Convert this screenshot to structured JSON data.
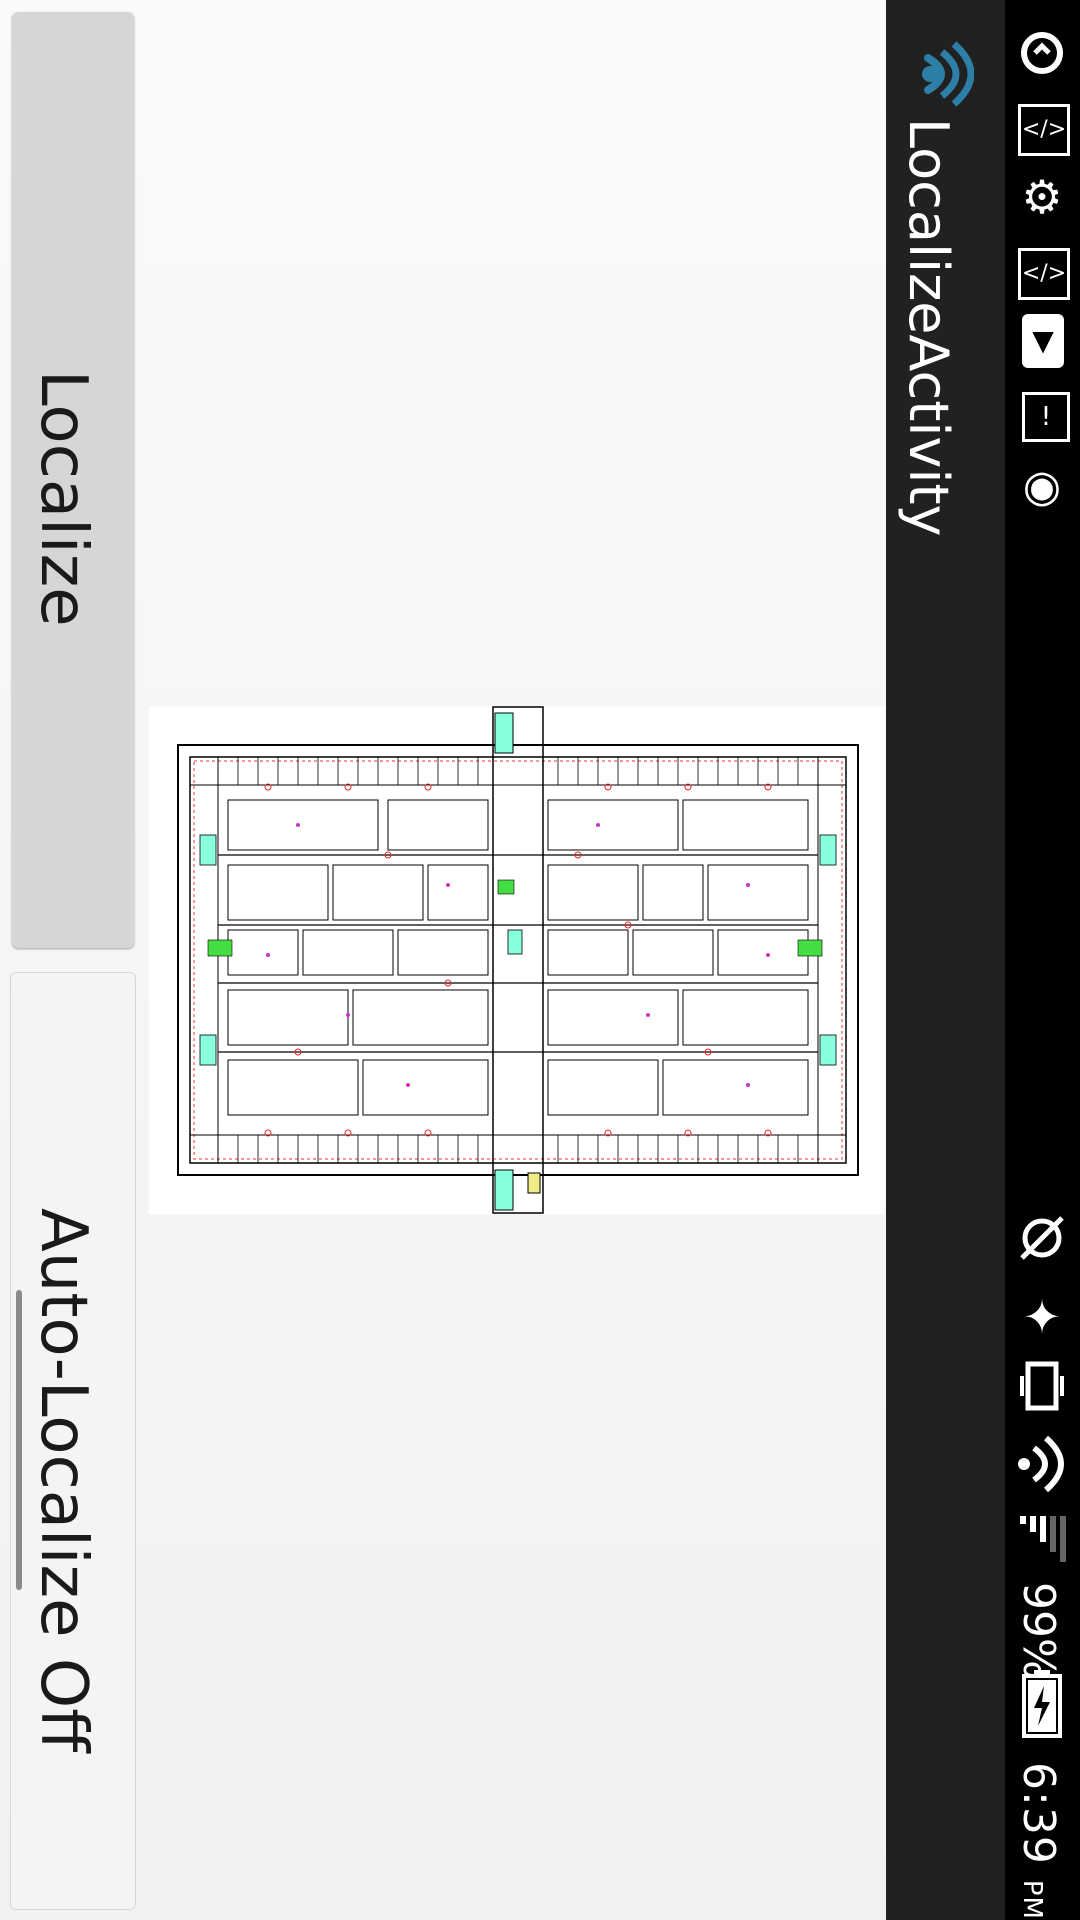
{
  "status_bar": {
    "time": "6:39",
    "time_suffix": "PM",
    "battery_percent": "99%",
    "icons": [
      "sync-icon",
      "code-icon",
      "usb-icon",
      "code-icon",
      "download-icon",
      "sd-card-alert-icon",
      "debug-icon",
      "sync-disabled-icon",
      "bluetooth-icon",
      "vibrate-icon",
      "wifi-icon",
      "signal-icon",
      "battery-charging-icon"
    ]
  },
  "action_bar": {
    "title": "LocalizeActivity",
    "app_icon": "wifi-logo-icon",
    "accent": "#2d7fa8"
  },
  "buttons": {
    "localize": "Localize",
    "auto_localize": "Auto-Localize Off"
  },
  "map": {
    "description_icon": "floor-plan-image"
  }
}
